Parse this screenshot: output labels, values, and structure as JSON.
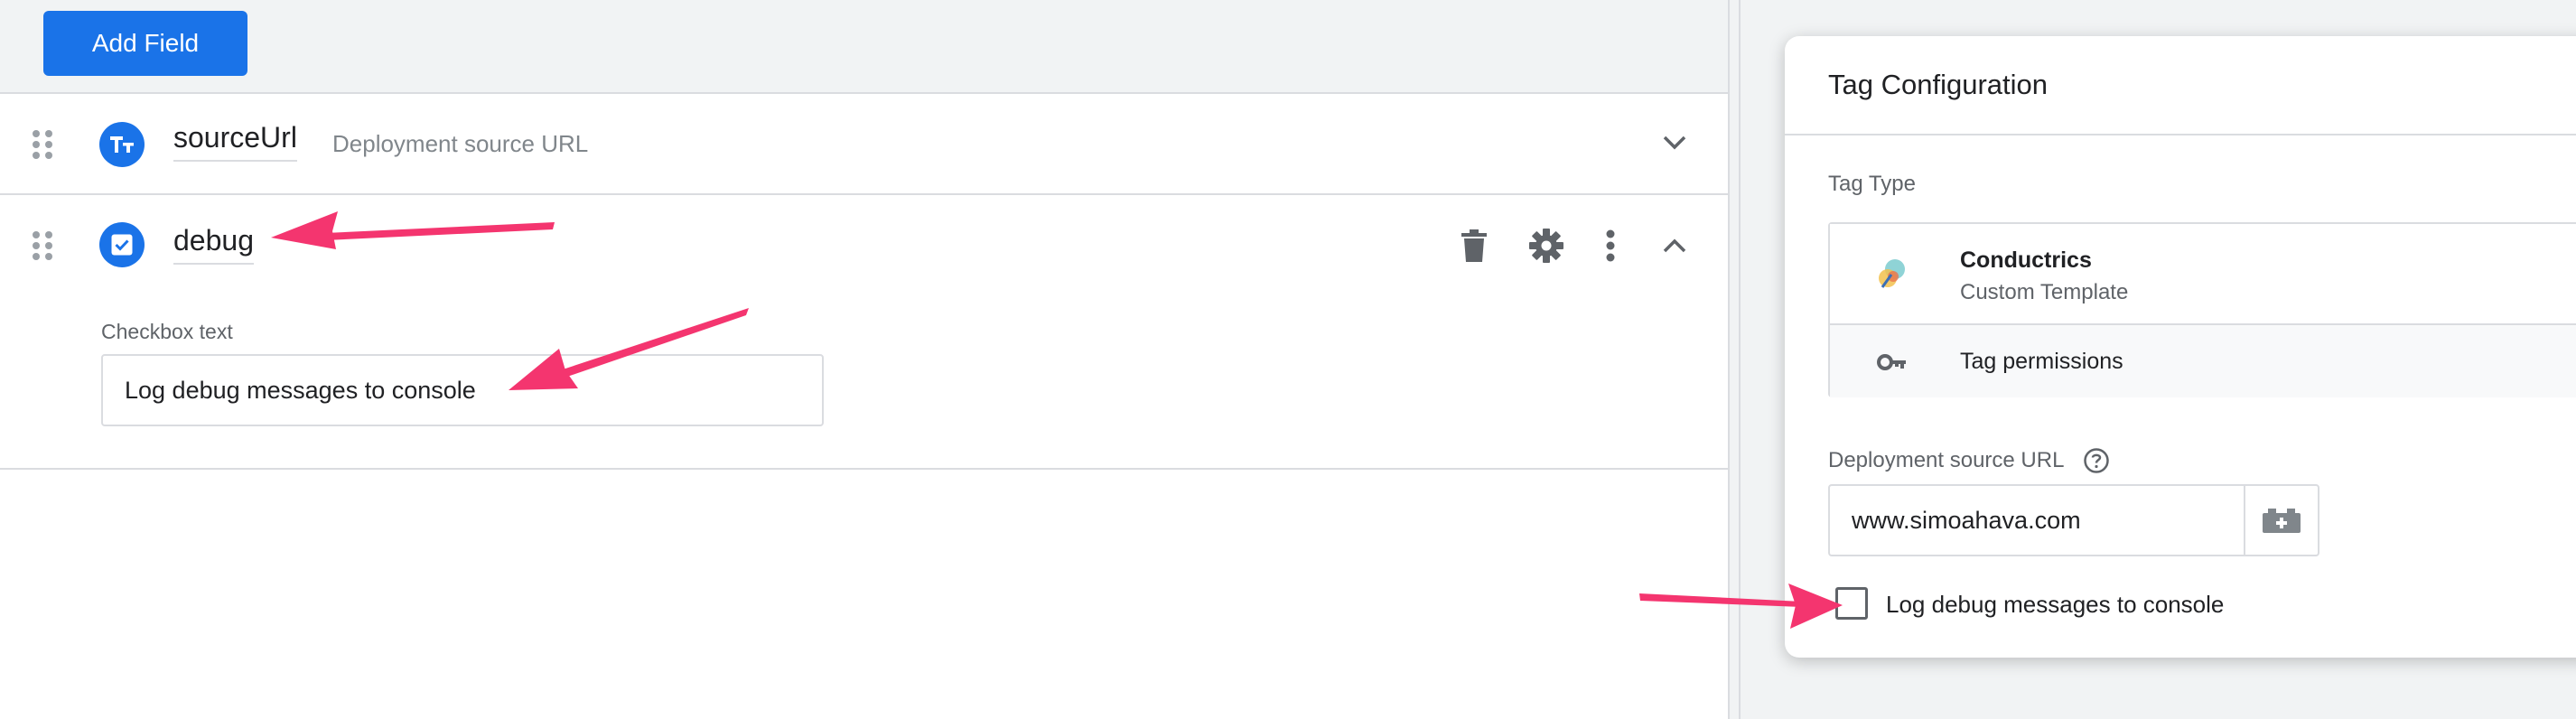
{
  "toolbar": {
    "add_field_label": "Add Field"
  },
  "fields": [
    {
      "name": "sourceUrl",
      "description": "Deployment source URL",
      "type_icon": "text-type-icon"
    },
    {
      "name": "debug",
      "description": "",
      "type_icon": "checkbox-type-icon"
    }
  ],
  "debug_expanded": {
    "checkbox_text_label": "Checkbox text",
    "checkbox_text_value": "Log debug messages to console"
  },
  "preview": {
    "card_title": "Tag Configuration",
    "tag_type_label": "Tag Type",
    "template": {
      "name": "Conductrics",
      "kind": "Custom Template"
    },
    "permissions_label": "Tag permissions",
    "deploy_label": "Deployment source URL",
    "deploy_value": "www.simoahava.com",
    "checkbox_label": "Log debug messages to console",
    "checkbox_checked": false
  },
  "colors": {
    "accent": "#1a73e8",
    "annotation_arrow": "#f4356f",
    "border": "#dadce0",
    "muted_text": "#5f6368"
  }
}
